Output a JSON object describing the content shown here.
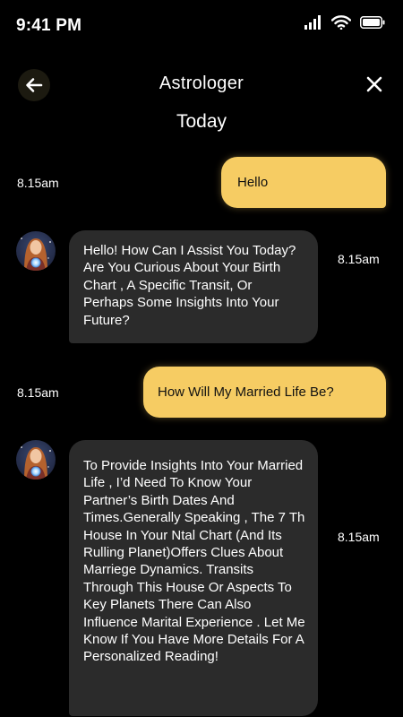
{
  "status_bar": {
    "time": "9:41 PM",
    "icons": [
      "signal-icon",
      "wifi-icon",
      "battery-icon"
    ]
  },
  "header": {
    "title": "Astrologer",
    "back_icon": "arrow-left-icon",
    "close_icon": "close-icon"
  },
  "date_label": "Today",
  "colors": {
    "accent": "#F6CC63",
    "incoming_bubble": "#2B2B2B",
    "background": "#000000"
  },
  "messages": [
    {
      "sender": "user",
      "text": "Hello",
      "time": "8.15am"
    },
    {
      "sender": "astrologer",
      "text": "Hello! How Can I Assist You Today? Are You Curious About Your Birth Chart , A Specific Transit, Or Perhaps Some Insights Into Your Future?",
      "time": "8.15am"
    },
    {
      "sender": "user",
      "text": "How Will My Married Life Be?",
      "time": "8.15am"
    },
    {
      "sender": "astrologer",
      "text": "To Provide Insights Into Your Married Life , I’d Need To Know Your Partner’s Birth Dates And Times.Generally Speaking , The 7 Th House In Your Ntal Chart (And Its Rulling Planet)Offers Clues About Marriege Dynamics. Transits Through This House Or Aspects To Key Planets There Can Also Influence Marital Experience . Let Me Know If You Have More Details For A Personalized Reading!",
      "time": "8.15am"
    }
  ]
}
